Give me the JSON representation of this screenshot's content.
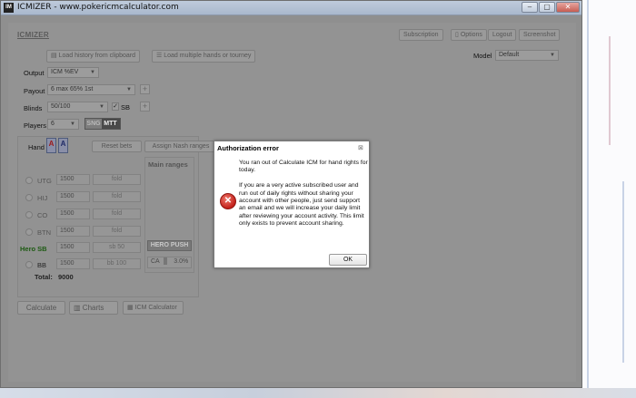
{
  "window": {
    "app_icon_text": "IM",
    "title": "ICMIZER - www.pokericmcalculator.com",
    "minimize": "–",
    "maximize": "▢",
    "close": "✕"
  },
  "header": {
    "logo": "ICMIZER",
    "nav": [
      "Subscription",
      "Options",
      "Logout",
      "Screenshot"
    ],
    "model_label": "Model",
    "model_value": "Default"
  },
  "toolbar": {
    "load_history": "Load history from clipboard",
    "load_multiple": "Load multiple hands or tourney"
  },
  "settings": {
    "output_label": "Output",
    "output_value": "ICM %EV",
    "payout_label": "Payout",
    "payout_value": "6 max 65% 1st",
    "blinds_label": "Blinds",
    "blinds_value": "50/100",
    "sb_label": "SB",
    "players_label": "Players",
    "players_value": "6",
    "mode_sng": "SNG",
    "mode_mtt": "MTT"
  },
  "hand": {
    "label": "Hand",
    "card1": "A",
    "card2": "A",
    "reset_bets": "Reset bets",
    "assign_nash": "Assign Nash ranges",
    "main_ranges": "Main ranges"
  },
  "positions": [
    {
      "name": "UTG",
      "stack": "1500",
      "action": "fold"
    },
    {
      "name": "HIJ",
      "stack": "1500",
      "action": "fold"
    },
    {
      "name": "CO",
      "stack": "1500",
      "action": "fold"
    },
    {
      "name": "BTN",
      "stack": "1500",
      "action": "fold"
    },
    {
      "name": "Hero SB",
      "stack": "1500",
      "action": "sb 50"
    },
    {
      "name": "BB",
      "stack": "1500",
      "action": "bb 100"
    }
  ],
  "total_label": "Total:",
  "total_value": "9000",
  "hero_push": "HERO PUSH",
  "ca_label": "CA",
  "ca_value": "3.0%",
  "bottom_buttons": {
    "calculate": "Calculate",
    "charts": "Charts",
    "icm_calculator": "ICM Calculator"
  },
  "dialog": {
    "title": "Authorization error",
    "close": "⊠",
    "paragraph1": "You ran out of Calculate ICM for hand rights for today.",
    "paragraph2": "If you are a very active subscribed user and run out of daily rights without sharing your account with other people, just send support an email and we will increase your daily limit after reviewing your account activity. This limit only exists to prevent account sharing.",
    "ok": "OK"
  }
}
